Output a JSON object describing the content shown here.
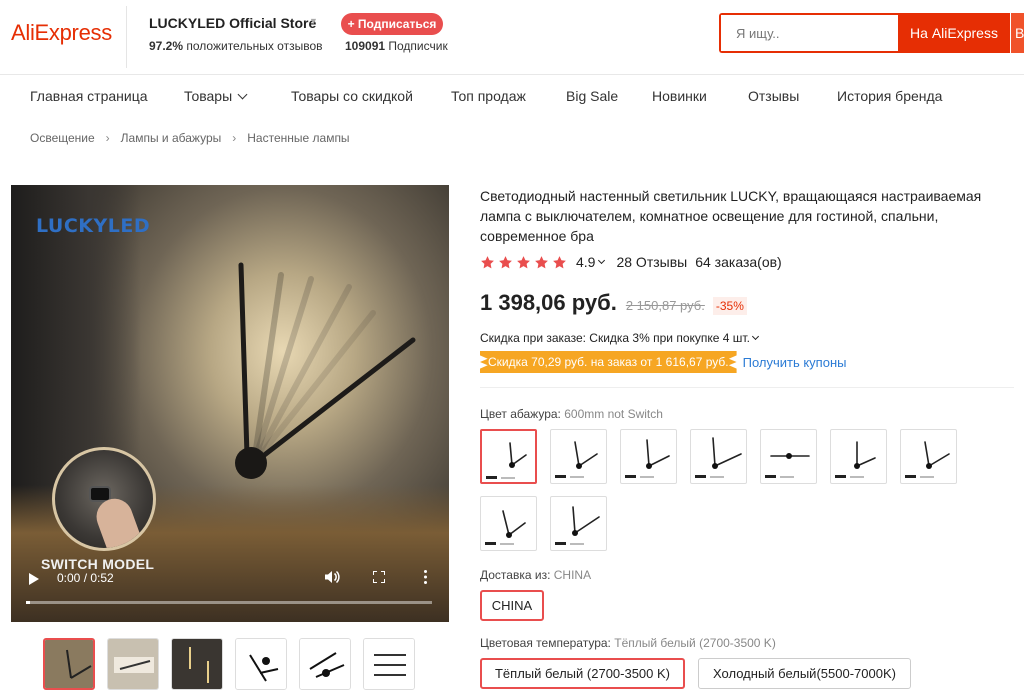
{
  "header": {
    "logo": "AliExpress",
    "store_name": "LUCKYLED Official Store",
    "store_rating_value": "97.2%",
    "store_rating_text": "положительных отзывов",
    "subscribe_label": "+ Подписаться",
    "subscribers_count": "109091",
    "subscribers_text": "Подписчик",
    "search_placeholder": "Я ищу..",
    "search_button": "На AliExpress",
    "search_button2": "В"
  },
  "nav": {
    "items": [
      "Главная страница",
      "Товары",
      "Товары со скидкой",
      "Топ продаж",
      "Big Sale",
      "Новинки",
      "Отзывы",
      "История бренда"
    ]
  },
  "breadcrumb": [
    "Освещение",
    "Лампы и абажуры",
    "Настенные лампы"
  ],
  "media": {
    "brand_overlay": "LUCKYLED",
    "overlay_caption": "SWITCH MODEL",
    "video_time": "0:00 / 0:52",
    "progress_fraction": 0.01,
    "thumbnail_count": 6
  },
  "product": {
    "title": "Светодиодный настенный светильник LUCKY, вращающаяся настраиваемая лампа с выключателем, комнатное освещение для гостиной, спальни, современное бра",
    "rating": "4.9",
    "stars": 5,
    "reviews": "28 Отзывы",
    "orders": "64 заказа(ов)",
    "price": "1 398,06 руб.",
    "old_price": "2 150,87 руб.",
    "discount": "-35%",
    "bulk_discount": "Скидка при заказе: Скидка 3% при покупке 4 шт.",
    "coupon_badge": "Скидка 70,29 руб. на заказ от 1 616,67 руб.",
    "coupon_link": "Получить купоны"
  },
  "options": {
    "shade_color_label": "Цвет абажура:",
    "shade_color_value": "600mm not Switch",
    "shade_color_count": 9,
    "ship_from_label": "Доставка из:",
    "ship_from_value": "CHINA",
    "ship_from_options": [
      "CHINA"
    ],
    "color_temp_label": "Цветовая температура:",
    "color_temp_value": "Тёплый белый (2700-3500 K)",
    "color_temp_options": [
      "Тёплый белый (2700-3500 K)",
      "Холодный белый(5500-7000K)"
    ]
  },
  "colors": {
    "brand": "#e62e04",
    "accent": "#e94e4e",
    "coupon": "#f6a623",
    "link": "#2b7bd5"
  }
}
